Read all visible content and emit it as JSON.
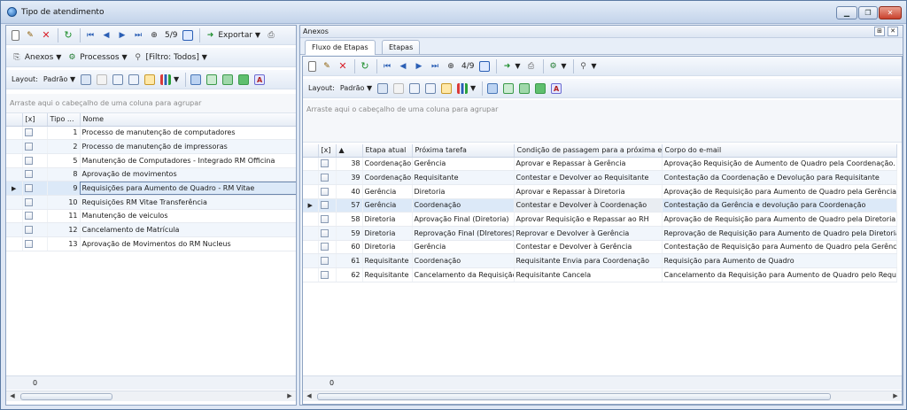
{
  "window": {
    "title": "Tipo de atendimento",
    "buttons": {
      "minimize": "▁",
      "restore": "❐",
      "close": "✕"
    }
  },
  "left": {
    "toolbar1": {
      "record_pos": "5/9",
      "export": "Exportar"
    },
    "toolbar2": {
      "anexos": "Anexos",
      "processos": "Processos",
      "filtro": "[Filtro: Todos]"
    },
    "toolbar3": {
      "layout": "Layout:",
      "padrao": "Padrão"
    },
    "group_hint": "Arraste aqui o cabeçalho de uma coluna para agrupar",
    "columns": {
      "check": "[x]",
      "tipo": "Tipo ...",
      "nome": "Nome"
    },
    "rows": [
      {
        "tipo": "1",
        "nome": "Processo de manutenção de computadores"
      },
      {
        "tipo": "2",
        "nome": "Processo de manutenção de impressoras"
      },
      {
        "tipo": "5",
        "nome": "Manutenção de Computadores - Integrado RM Officina"
      },
      {
        "tipo": "8",
        "nome": "Aprovação de movimentos"
      },
      {
        "tipo": "9",
        "nome": "Requisições para Aumento de Quadro - RM Vitae"
      },
      {
        "tipo": "10",
        "nome": "Requisições RM Vitae Transferência"
      },
      {
        "tipo": "11",
        "nome": "Manutenção de veiculos"
      },
      {
        "tipo": "12",
        "nome": "Cancelamento de Matrícula"
      },
      {
        "tipo": "13",
        "nome": "Aprovação de Movimentos do RM Nucleus"
      }
    ],
    "footer_count": "0"
  },
  "right": {
    "caption": "Anexos",
    "caption_buttons": {
      "pin": "⊞",
      "close": "✕"
    },
    "tabs": [
      "Fluxo de Etapas",
      "Etapas"
    ],
    "toolbar1": {
      "record_pos": "4/9"
    },
    "toolbar2": {
      "layout": "Layout:",
      "padrao": "Padrão"
    },
    "group_hint": "Arraste aqui o cabeçalho de uma coluna para agrupar",
    "columns": {
      "check": "[x]",
      "id": "",
      "etapa": "Etapa atual",
      "proxima": "Próxima tarefa",
      "condicao": "Condição de passagem para a próxima e...",
      "corpo": "Corpo do e-mail"
    },
    "rows": [
      {
        "id": "38",
        "etapa": "Coordenação",
        "proxima": "Gerência",
        "condicao": "Aprovar e Repassar à Gerência",
        "corpo": "Aprovação Requisição de Aumento de Quadro pela Coordenação."
      },
      {
        "id": "39",
        "etapa": "Coordenação",
        "proxima": "Requisitante",
        "condicao": "Contestar e Devolver ao Requisitante",
        "corpo": "Contestação da Coordenação e Devolução para Requisitante"
      },
      {
        "id": "40",
        "etapa": "Gerência",
        "proxima": "Diretoria",
        "condicao": "Aprovar e Repassar à Diretoria",
        "corpo": "Aprovação de Requisição para Aumento de Quadro pela Gerência"
      },
      {
        "id": "57",
        "etapa": "Gerência",
        "proxima": "Coordenação",
        "condicao": "Contestar e Devolver à Coordenação",
        "corpo": "Contestação da Gerência e devolução para Coordenação"
      },
      {
        "id": "58",
        "etapa": "Diretoria",
        "proxima": "Aprovação Final (Diretoria)",
        "condicao": "Aprovar Requisição e Repassar ao RH",
        "corpo": "Aprovação de Requisição para Aumento de Quadro pela Diretoria"
      },
      {
        "id": "59",
        "etapa": "Diretoria",
        "proxima": "Reprovação Final (DIretores)",
        "condicao": "Reprovar e Devolver à Gerência",
        "corpo": "Reprovação de Requisição para Aumento de Quadro pela Diretoria"
      },
      {
        "id": "60",
        "etapa": "Diretoria",
        "proxima": "Gerência",
        "condicao": "Contestar e Devolver à Gerência",
        "corpo": "Contestação de Requisição para Aumento de Quadro pela Gerência"
      },
      {
        "id": "61",
        "etapa": "Requisitante",
        "proxima": "Coordenação",
        "condicao": "Requisitante Envia para Coordenação",
        "corpo": "Requisição para Aumento de Quadro"
      },
      {
        "id": "62",
        "etapa": "Requisitante",
        "proxima": "Cancelamento da Requisição",
        "condicao": "Requisitante Cancela",
        "corpo": "Cancelamento da Requisição para Aumento de Quadro pelo Requisitante"
      }
    ],
    "footer_count": "0"
  }
}
